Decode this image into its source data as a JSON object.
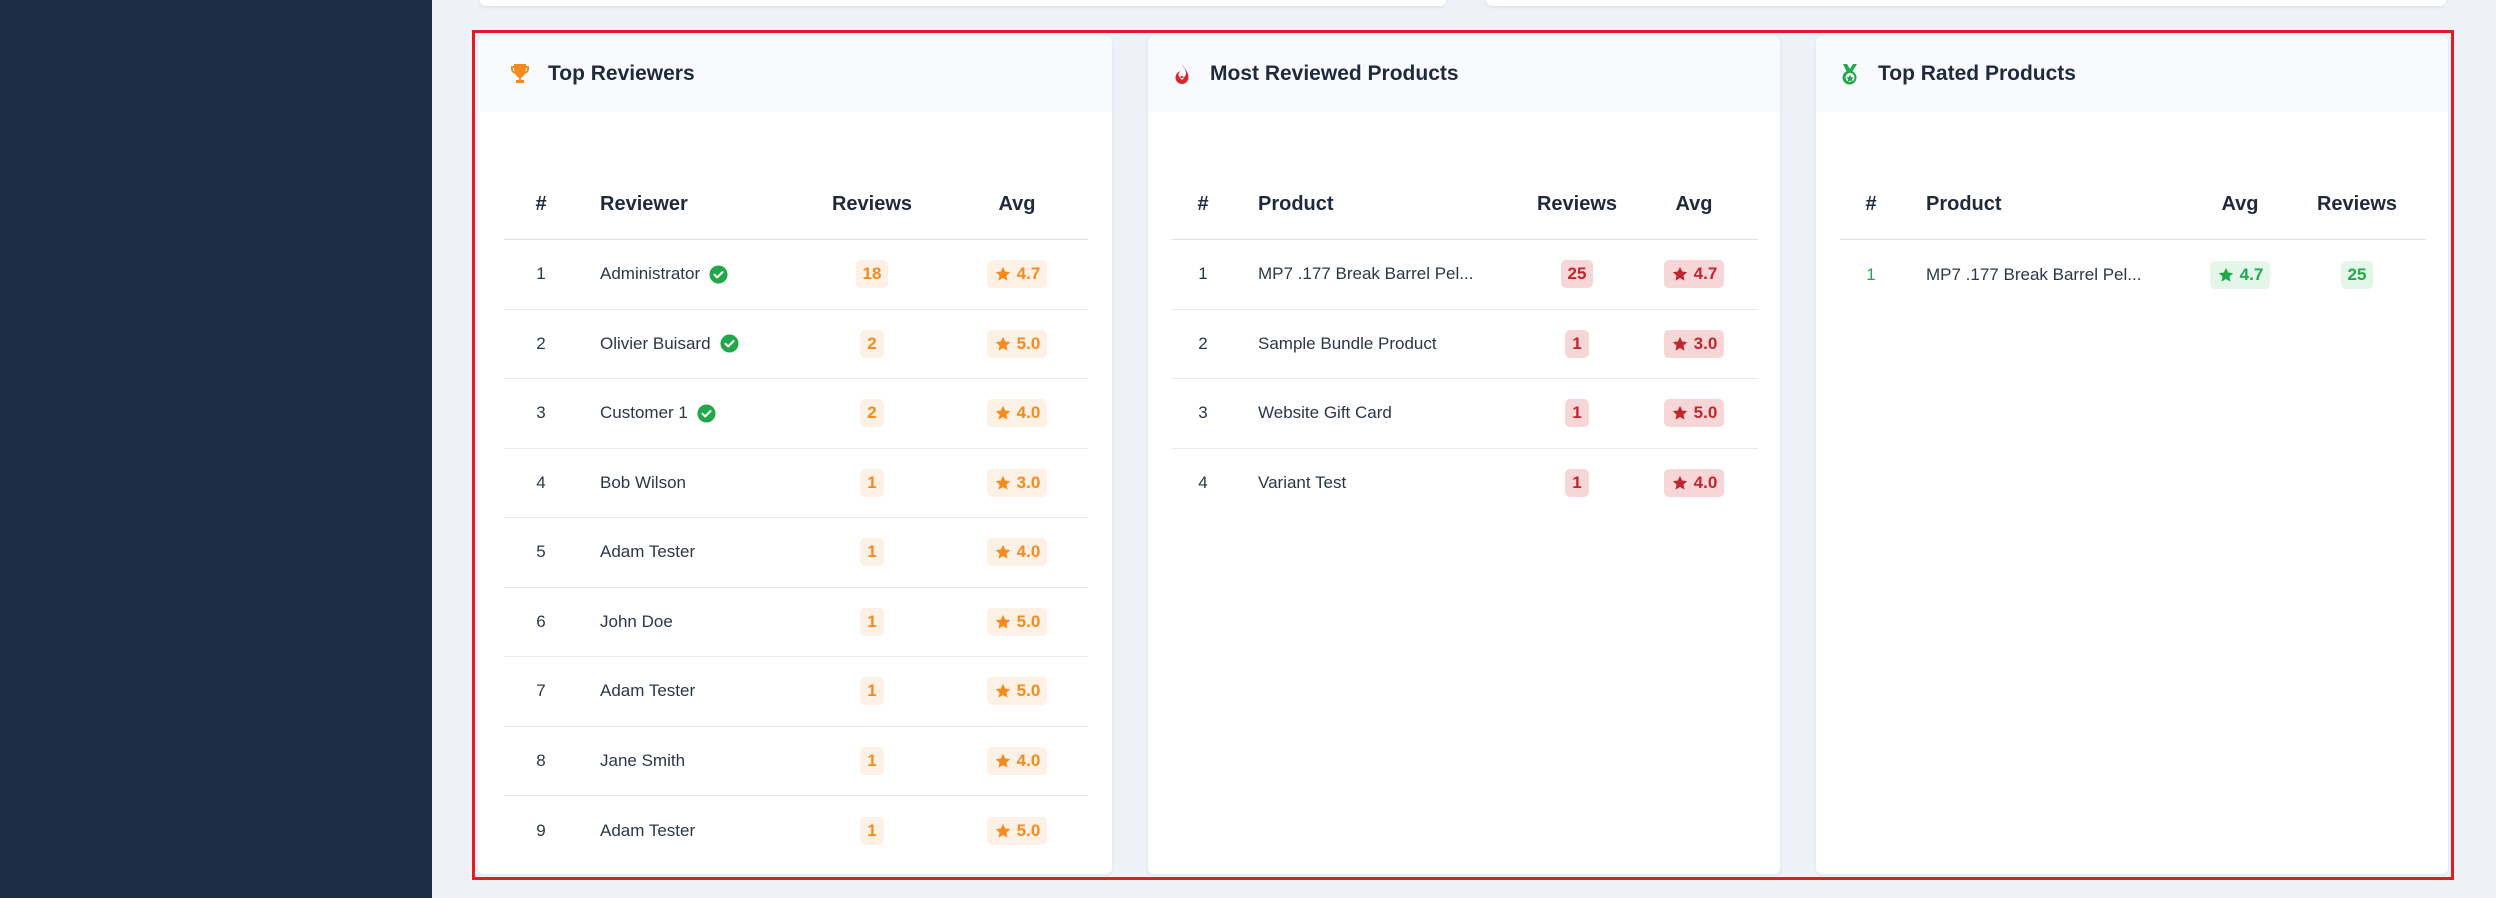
{
  "colors": {
    "sidebar": "#1e2c44",
    "highlight": "#e31b23",
    "orange": "#f28c1e",
    "red": "#c0262d",
    "green": "#22a84a"
  },
  "top_reviewers": {
    "title": "Top Reviewers",
    "icon": "trophy-icon",
    "columns": [
      "#",
      "Reviewer",
      "Reviews",
      "Avg"
    ],
    "rows": [
      {
        "rank": "1",
        "name": "Administrator",
        "verified": true,
        "reviews": "18",
        "avg": "4.7"
      },
      {
        "rank": "2",
        "name": "Olivier Buisard",
        "verified": true,
        "reviews": "2",
        "avg": "5.0"
      },
      {
        "rank": "3",
        "name": "Customer 1",
        "verified": true,
        "reviews": "2",
        "avg": "4.0"
      },
      {
        "rank": "4",
        "name": "Bob Wilson",
        "verified": false,
        "reviews": "1",
        "avg": "3.0"
      },
      {
        "rank": "5",
        "name": "Adam Tester",
        "verified": false,
        "reviews": "1",
        "avg": "4.0"
      },
      {
        "rank": "6",
        "name": "John Doe",
        "verified": false,
        "reviews": "1",
        "avg": "5.0"
      },
      {
        "rank": "7",
        "name": "Adam Tester",
        "verified": false,
        "reviews": "1",
        "avg": "5.0"
      },
      {
        "rank": "8",
        "name": "Jane Smith",
        "verified": false,
        "reviews": "1",
        "avg": "4.0"
      },
      {
        "rank": "9",
        "name": "Adam Tester",
        "verified": false,
        "reviews": "1",
        "avg": "5.0"
      }
    ]
  },
  "most_reviewed": {
    "title": "Most Reviewed Products",
    "icon": "fire-icon",
    "columns": [
      "#",
      "Product",
      "Reviews",
      "Avg"
    ],
    "rows": [
      {
        "rank": "1",
        "product": "MP7 .177 Break Barrel Pel...",
        "reviews": "25",
        "avg": "4.7"
      },
      {
        "rank": "2",
        "product": "Sample Bundle Product",
        "reviews": "1",
        "avg": "3.0"
      },
      {
        "rank": "3",
        "product": "Website Gift Card",
        "reviews": "1",
        "avg": "5.0"
      },
      {
        "rank": "4",
        "product": "Variant Test",
        "reviews": "1",
        "avg": "4.0"
      }
    ]
  },
  "top_rated": {
    "title": "Top Rated Products",
    "icon": "medal-icon",
    "columns": [
      "#",
      "Product",
      "Avg",
      "Reviews"
    ],
    "rows": [
      {
        "rank": "1",
        "product": "MP7 .177 Break Barrel Pel...",
        "avg": "4.7",
        "reviews": "25"
      }
    ]
  }
}
